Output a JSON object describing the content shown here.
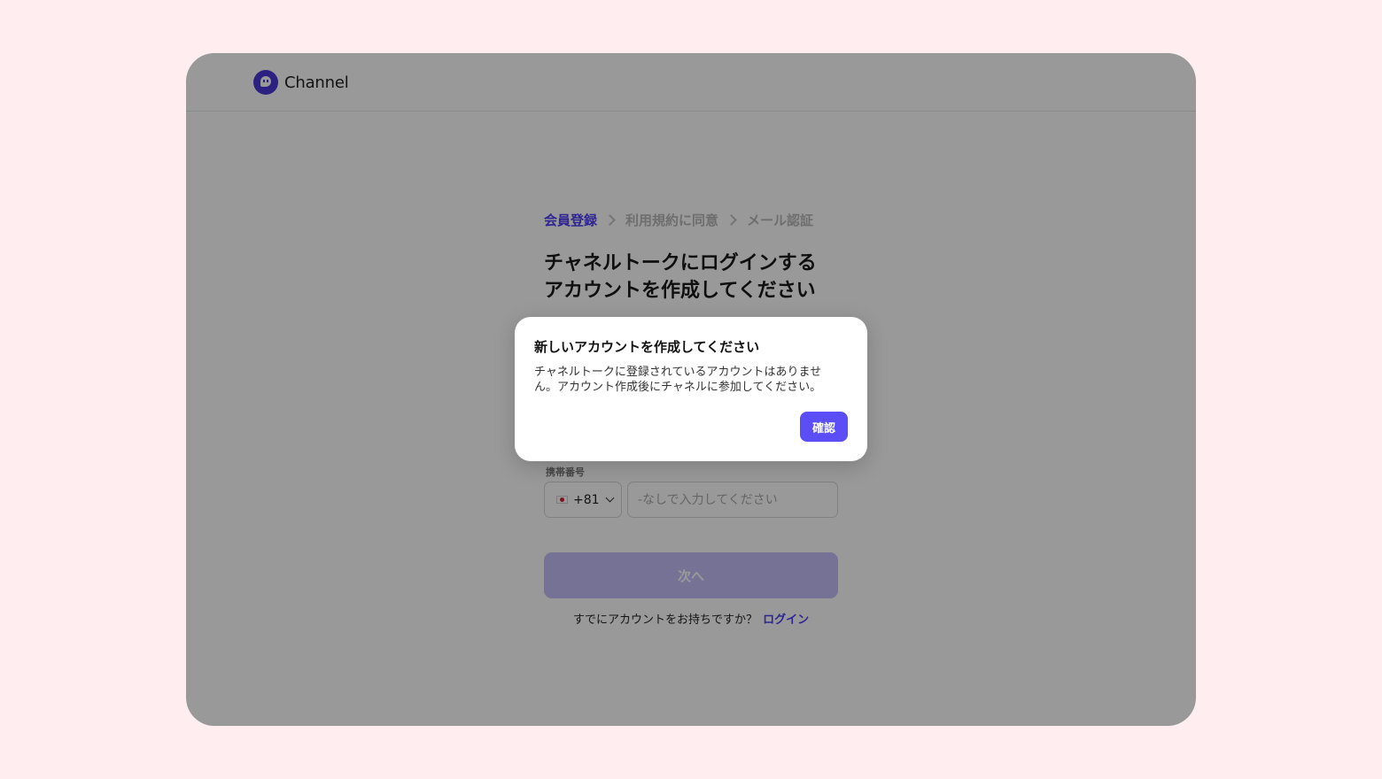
{
  "header": {
    "logo_text": "Channel"
  },
  "steps": [
    {
      "label": "会員登録",
      "active": true
    },
    {
      "label": "利用規約に同意",
      "active": false
    },
    {
      "label": "メール認証",
      "active": false
    }
  ],
  "form": {
    "title": "チャネルトークにログインする\nアカウントを作成してください",
    "phone_label": "携帯番号",
    "country_code": "+81",
    "phone_placeholder": "-なしで入力してください",
    "next_label": "次へ",
    "have_account_text": "すでにアカウントをお持ちですか？",
    "login_link": "ログイン"
  },
  "modal": {
    "title": "新しいアカウントを作成してください",
    "body": "チャネルトークに登録されているアカウントはありません。アカウント作成後にチャネルに参加してください。",
    "confirm_label": "確認"
  },
  "colors": {
    "accent": "#5b4ef6",
    "step_active": "#4e3ef5",
    "page_background": "#ffedf0"
  },
  "icons": {
    "logo": "channel-logo-icon",
    "step_separator": "chevron-right-icon",
    "country_flag": "japan-flag-icon",
    "dropdown": "chevron-down-icon"
  }
}
